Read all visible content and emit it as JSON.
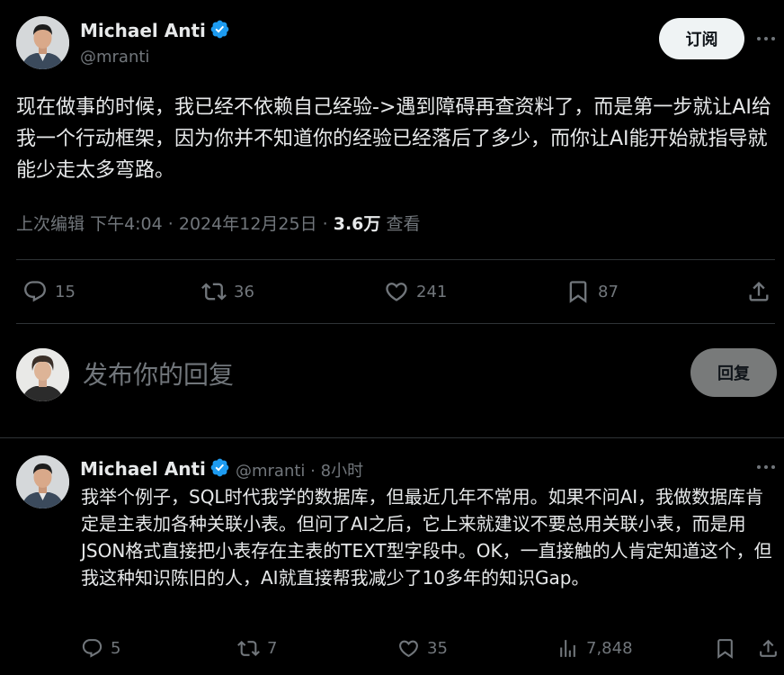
{
  "main_tweet": {
    "author_name": "Michael Anti",
    "handle": "@mranti",
    "follow_label": "订阅",
    "text": "现在做事的时候，我已经不依赖自己经验->遇到障碍再查资料了，而是第一步就让AI给我一个行动框架，因为你并不知道你的经验已经落后了多少，而你让AI能开始就指导就能少走太多弯路。",
    "edited_label": "上次编辑",
    "time": "下午4:04",
    "date": "2024年12月25日",
    "views_count": "3.6万",
    "views_label": "查看",
    "separator": "·",
    "replies": "15",
    "retweets": "36",
    "likes": "241",
    "bookmarks": "87"
  },
  "composer": {
    "placeholder": "发布你的回复",
    "reply_label": "回复"
  },
  "reply_tweet": {
    "author_name": "Michael Anti",
    "handle": "@mranti",
    "separator": "·",
    "time_ago": "8小时",
    "text": "我举个例子，SQL时代我学的数据库，但最近几年不常用。如果不问AI，我做数据库肯定是主表加各种关联小表。但问了AI之后，它上来就建议不要总用关联小表，而是用JSON格式直接把小表存在主表的TEXT型字段中。OK，一直接触的人肯定知道这个，但我这种知识陈旧的人，AI就直接帮我减少了10多年的知识Gap。",
    "replies": "5",
    "retweets": "7",
    "likes": "35",
    "views": "7,848"
  },
  "colors": {
    "background": "#000000",
    "text": "#e7e9ea",
    "muted": "#71767b",
    "verified": "#1d9bf0",
    "divider": "#2f3336"
  }
}
